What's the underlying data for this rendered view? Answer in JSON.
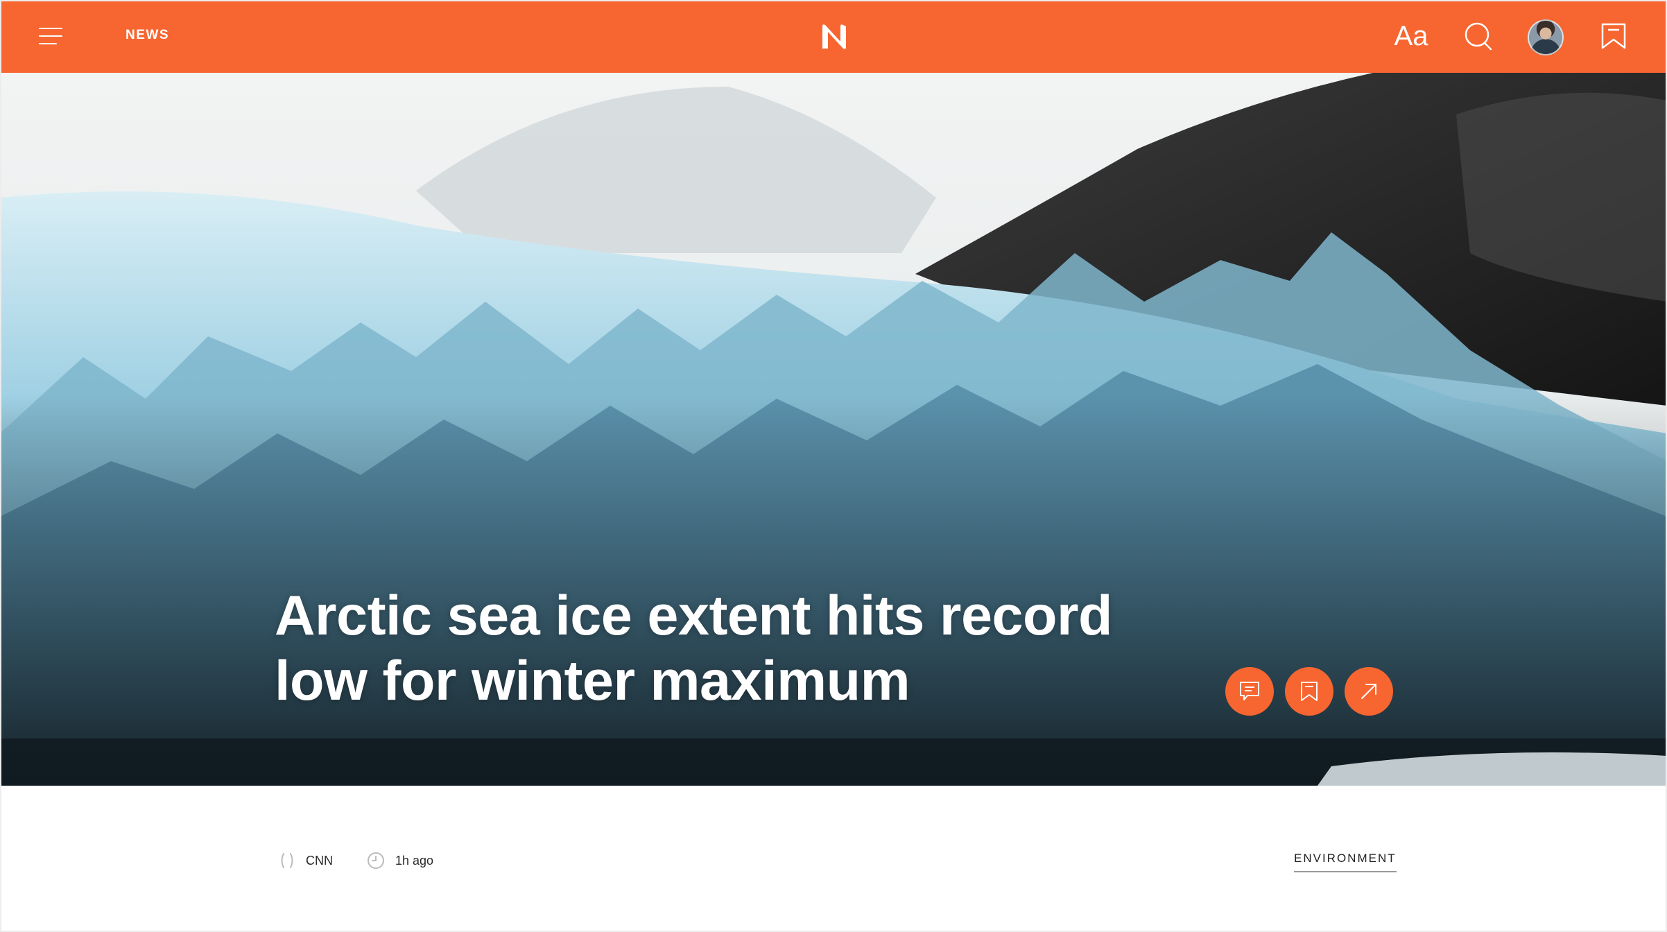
{
  "header": {
    "nav_label": "NEWS",
    "logo_text": "N",
    "font_label": "Aa",
    "brand_color": "#f76631",
    "icons": [
      "hamburger-menu-icon",
      "search-icon",
      "avatar",
      "bookmark-icon"
    ]
  },
  "article": {
    "headline_line1": "Arctic sea ice extent hits record",
    "headline_line2": "low for winter maximum",
    "actions": [
      "comment-icon",
      "bookmark-icon",
      "share-arrow-icon"
    ],
    "source": "CNN",
    "time": "1h ago",
    "category": "ENVIRONMENT"
  }
}
